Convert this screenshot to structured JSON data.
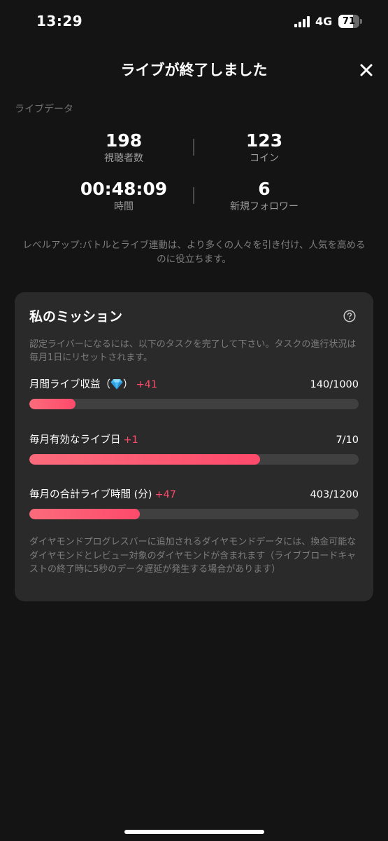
{
  "status_bar": {
    "time": "13:29",
    "network": "4G",
    "battery_level": "71"
  },
  "header": {
    "title": "ライブが終了しました",
    "close_icon": "close-icon"
  },
  "live_data": {
    "section_label": "ライブデータ",
    "stats": [
      {
        "value": "198",
        "label": "視聴者数"
      },
      {
        "value": "123",
        "label": "コイン"
      },
      {
        "value": "00:48:09",
        "label": "時間"
      },
      {
        "value": "6",
        "label": "新規フォロワー"
      }
    ],
    "level_note": "レベルアップ:バトルとライブ連動は、より多くの人々を引き付け、人気を高めるのに役立ちます。"
  },
  "mission": {
    "title": "私のミッション",
    "help_icon": "question-circle-icon",
    "description": "認定ライバーになるには、以下のタスクを完了して下さい。タスクの進行状況は毎月1日にリセットされます。",
    "tasks": [
      {
        "name": "月間ライブ収益（",
        "name_suffix": "）",
        "icon": "diamond-icon",
        "delta": "+41",
        "progress_text": "140/1000",
        "progress": 0.14
      },
      {
        "name": "毎月有効なライブ日",
        "delta": "+1",
        "progress_text": "7/10",
        "progress": 0.7
      },
      {
        "name": "毎月の合計ライブ時間 (分)",
        "delta": "+47",
        "progress_text": "403/1200",
        "progress": 0.336
      }
    ],
    "footnote": "ダイヤモンドプログレスバーに追加されるダイヤモンドデータには、換金可能なダイヤモンドとレビュー対象のダイヤモンドが含まれます（ライブブロードキャストの終了時に5秒のデータ遅延が発生する場合があります）"
  },
  "colors": {
    "background": "#141414",
    "card": "#2a2a2a",
    "accent": "#fe4a6b",
    "track": "#404040"
  }
}
